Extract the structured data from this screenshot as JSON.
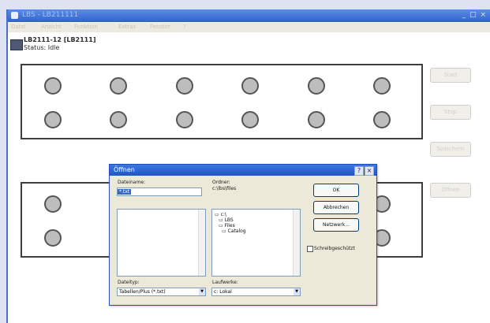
{
  "window": {
    "title": "LBS - LB211111",
    "controls": "_ □ ×"
  },
  "menu": {
    "items": [
      "Datei",
      "Ansicht",
      "Funktion",
      "Extras",
      "Fenster",
      "?"
    ]
  },
  "device": {
    "name": "LB2111-12 [LB2111]",
    "status": "Status: Idle"
  },
  "side_buttons": {
    "start": "Start",
    "stop": "Stop",
    "b3": "Speichern",
    "b4": "Öffnen"
  },
  "dialog": {
    "title": "Öffnen",
    "help": "?",
    "close": "×",
    "filename_label": "Dateiname:",
    "filename_value": "*.txt",
    "folders_label": "Ordner:",
    "folders_path": "c:\\lbs\\files",
    "directories": [
      "c:\\",
      "LBS",
      "Files",
      "Catalog"
    ],
    "filetype_label": "Dateityp:",
    "filetype_value": "Tabellen/Plus (*.txt)",
    "drives_label": "Laufwerke:",
    "drives_value": "c: Lokal",
    "ok": "OK",
    "cancel": "Abbrechen",
    "network": "Netzwerk...",
    "readonly": "Schreibgeschützt"
  },
  "plates": [
    {
      "rows": 2,
      "cols": 6
    },
    {
      "rows": 2,
      "cols": 6
    }
  ]
}
